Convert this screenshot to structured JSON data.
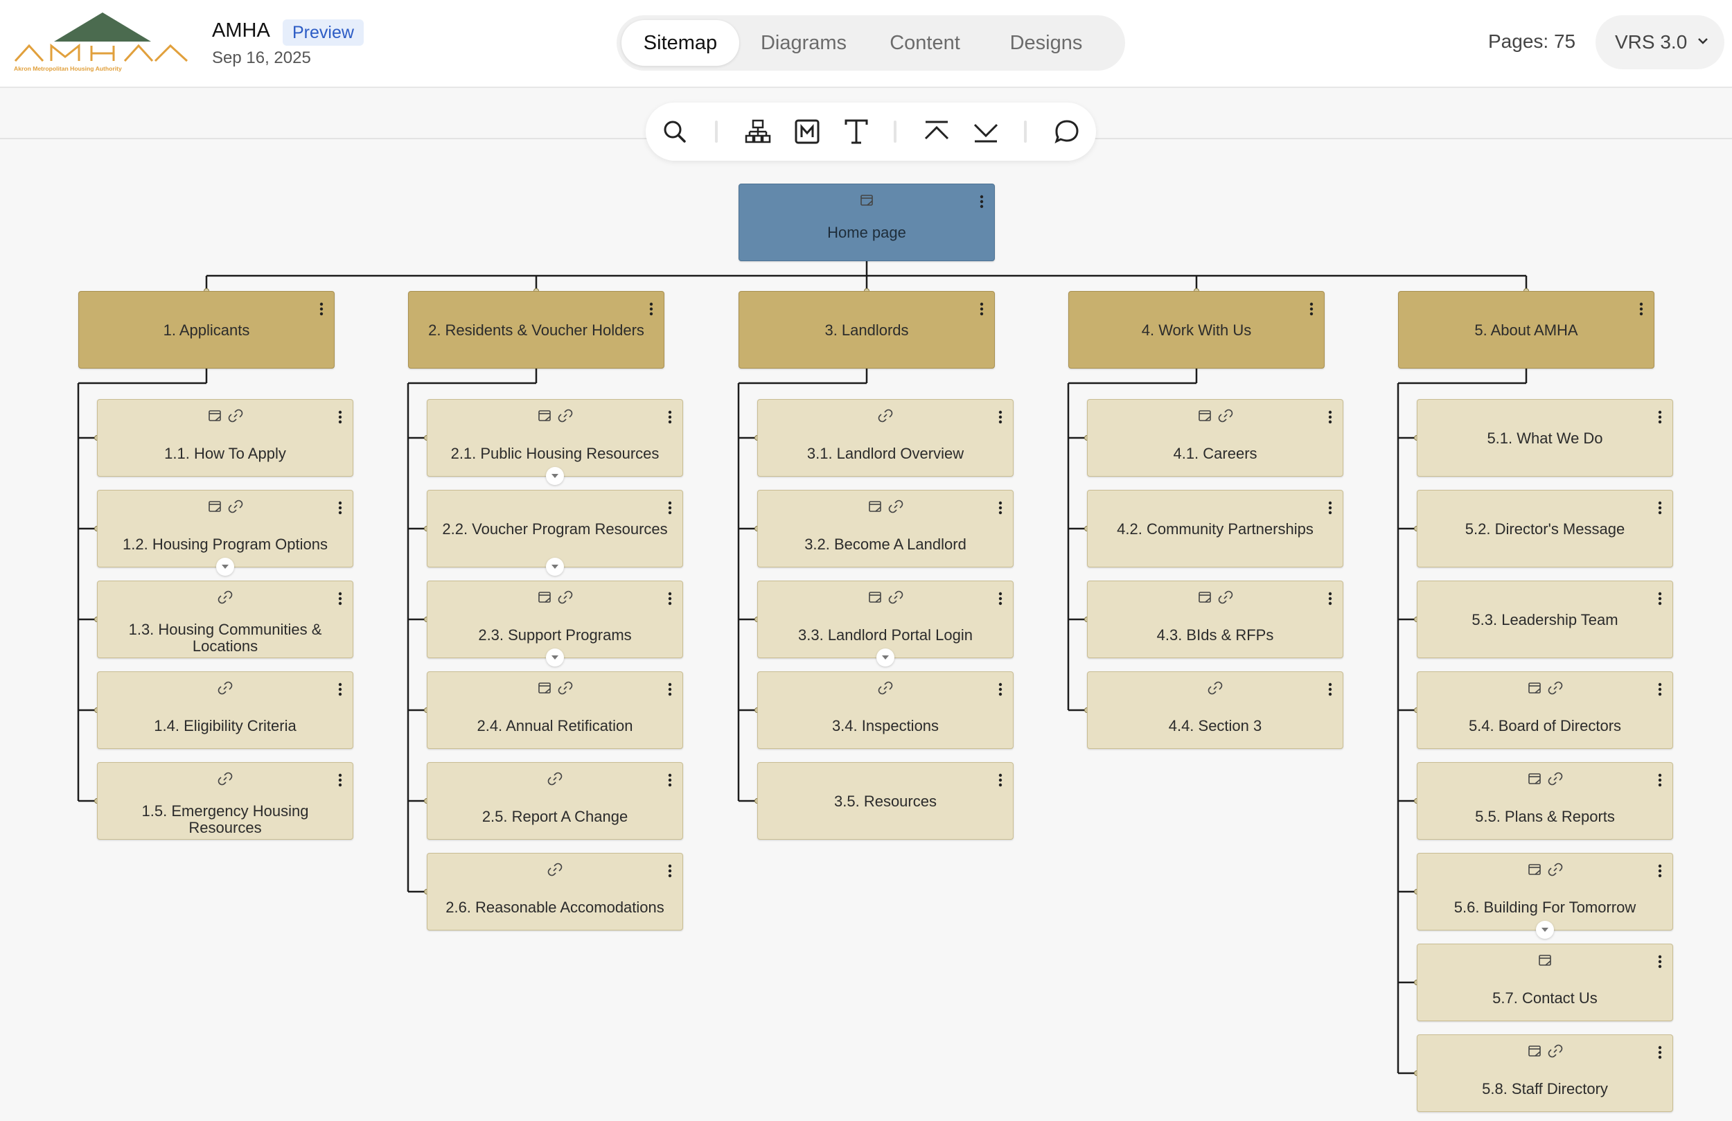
{
  "app": {
    "title": "AMHA",
    "badge": "Preview",
    "date": "Sep 16, 2025",
    "logo_text": "Akron Metropolitan Housing Authority"
  },
  "tabs": [
    "Sitemap",
    "Diagrams",
    "Content",
    "Designs"
  ],
  "active_tab": "Sitemap",
  "pages_count": "Pages: 75",
  "version": "VRS 3.0",
  "toolbar": [
    "search-icon",
    "hierarchy-icon",
    "markdown-icon",
    "text-icon",
    "collapse-up-icon",
    "expand-down-icon",
    "comment-icon"
  ],
  "colors": {
    "root_node": "#6389ab",
    "section_node": "#c8b06e",
    "page_node": "#e8e0c4",
    "logo_green": "#4b6b4f",
    "logo_orange": "#e1a03c",
    "badge_blue": "#2c5cc5"
  },
  "sitemap": {
    "root": {
      "label": "Home page",
      "icons": [
        "page-icon"
      ]
    },
    "sections": [
      {
        "label": "1. Applicants",
        "children": [
          {
            "label": "1.1. How To Apply",
            "icons": [
              "page-icon",
              "link-icon"
            ],
            "expandable": false
          },
          {
            "label": "1.2. Housing Program Options",
            "icons": [
              "page-icon",
              "link-icon"
            ],
            "expandable": true
          },
          {
            "label": "1.3. Housing Communities & Locations",
            "icons": [
              "link-icon"
            ],
            "expandable": false
          },
          {
            "label": "1.4. Eligibility Criteria",
            "icons": [
              "link-icon"
            ],
            "expandable": false
          },
          {
            "label": "1.5. Emergency Housing Resources",
            "icons": [
              "link-icon"
            ],
            "expandable": false
          }
        ]
      },
      {
        "label": "2. Residents & Voucher Holders",
        "children": [
          {
            "label": "2.1. Public Housing Resources",
            "icons": [
              "page-icon",
              "link-icon"
            ],
            "expandable": true
          },
          {
            "label": "2.2. Voucher Program Resources",
            "icons": [],
            "expandable": true
          },
          {
            "label": "2.3. Support Programs",
            "icons": [
              "page-icon",
              "link-icon"
            ],
            "expandable": true
          },
          {
            "label": "2.4. Annual Retification",
            "icons": [
              "page-icon",
              "link-icon"
            ],
            "expandable": false
          },
          {
            "label": "2.5. Report A Change",
            "icons": [
              "link-icon"
            ],
            "expandable": false
          },
          {
            "label": "2.6. Reasonable Accomodations",
            "icons": [
              "link-icon"
            ],
            "expandable": false
          }
        ]
      },
      {
        "label": "3. Landlords",
        "children": [
          {
            "label": "3.1. Landlord Overview",
            "icons": [
              "link-icon"
            ],
            "expandable": false
          },
          {
            "label": "3.2. Become A Landlord",
            "icons": [
              "page-icon",
              "link-icon"
            ],
            "expandable": false
          },
          {
            "label": "3.3. Landlord Portal Login",
            "icons": [
              "page-icon",
              "link-icon"
            ],
            "expandable": true
          },
          {
            "label": "3.4. Inspections",
            "icons": [
              "link-icon"
            ],
            "expandable": false
          },
          {
            "label": "3.5. Resources",
            "icons": [],
            "expandable": false
          }
        ]
      },
      {
        "label": "4. Work With Us",
        "children": [
          {
            "label": "4.1. Careers",
            "icons": [
              "page-icon",
              "link-icon"
            ],
            "expandable": false
          },
          {
            "label": "4.2. Community Partnerships",
            "icons": [],
            "expandable": false
          },
          {
            "label": "4.3. BIds & RFPs",
            "icons": [
              "page-icon",
              "link-icon"
            ],
            "expandable": false
          },
          {
            "label": "4.4. Section 3",
            "icons": [
              "link-icon"
            ],
            "expandable": false
          }
        ]
      },
      {
        "label": "5. About AMHA",
        "children": [
          {
            "label": "5.1. What We Do",
            "icons": [],
            "expandable": false
          },
          {
            "label": "5.2. Director's Message",
            "icons": [],
            "expandable": false
          },
          {
            "label": "5.3. Leadership Team",
            "icons": [],
            "expandable": false
          },
          {
            "label": "5.4. Board of Directors",
            "icons": [
              "page-icon",
              "link-icon"
            ],
            "expandable": false
          },
          {
            "label": "5.5. Plans & Reports",
            "icons": [
              "page-icon",
              "link-icon"
            ],
            "expandable": false
          },
          {
            "label": "5.6. Building For Tomorrow",
            "icons": [
              "page-icon",
              "link-icon"
            ],
            "expandable": true
          },
          {
            "label": "5.7. Contact Us",
            "icons": [
              "page-icon"
            ],
            "expandable": false
          },
          {
            "label": "5.8. Staff Directory",
            "icons": [
              "page-icon",
              "link-icon"
            ],
            "expandable": false
          }
        ]
      }
    ]
  }
}
